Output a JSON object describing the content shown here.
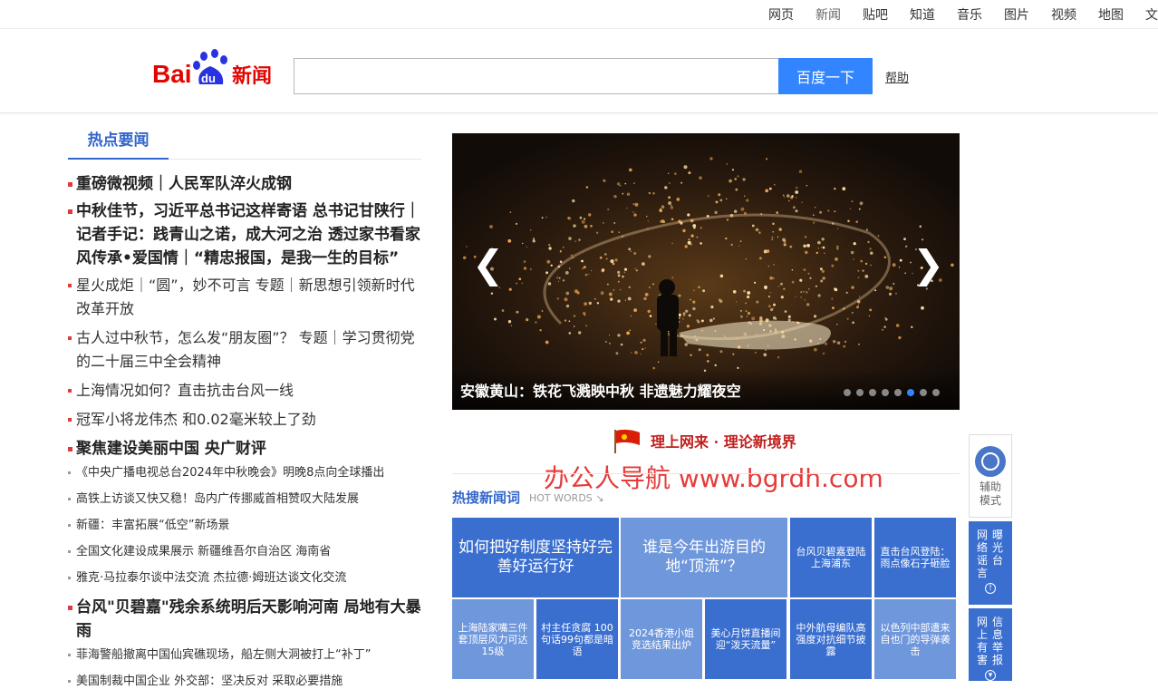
{
  "topnav": {
    "items": [
      "网页",
      "新闻",
      "贴吧",
      "知道",
      "音乐",
      "图片",
      "视频",
      "地图",
      "文库"
    ],
    "active": "新闻"
  },
  "header": {
    "logo_text": "Bai du 新闻",
    "search_value": "",
    "search_button": "百度一下",
    "help": "帮助"
  },
  "hot": {
    "tab_label": "热点要闻",
    "items": [
      {
        "style": "hl",
        "text": "重磅微视频｜人民军队淬火成钢"
      },
      {
        "style": "hl",
        "text": "中秋佳节，习近平总书记这样寄语 总书记甘陕行｜记者手记：践青山之诺，成大河之治 透过家书看家风传承•爱国情｜“精忠报国，是我一生的目标”"
      },
      {
        "style": "md",
        "text": "星火成炬｜“圆”，妙不可言 专题｜新思想引领新时代改革开放"
      },
      {
        "style": "md",
        "text": "古人过中秋节，怎么发“朋友圈”？ 专题｜学习贯彻党的二十届三中全会精神"
      },
      {
        "style": "md",
        "text": "上海情况如何？直击抗击台风一线"
      },
      {
        "style": "md",
        "text": "冠军小将龙伟杰 和0.02毫米较上了劲"
      },
      {
        "style": "hl",
        "text": "聚焦建设美丽中国 央广财评"
      },
      {
        "style": "sm",
        "text": "《中央广播电视总台2024年中秋晚会》明晚8点向全球播出"
      },
      {
        "style": "sm",
        "text": "高铁上访谈又快又稳！岛内广传挪威首相赞叹大陆发展"
      },
      {
        "style": "sm",
        "text": "新疆：丰富拓展“低空”新场景"
      },
      {
        "style": "sm",
        "text": "全国文化建设成果展示 新疆维吾尔自治区 海南省"
      },
      {
        "style": "sm",
        "text": "雅克·马拉泰尔谈中法交流 杰拉德·姆班达谈文化交流"
      },
      {
        "style": "hl",
        "text": "台风\"贝碧嘉\"残余系统明后天影响河南 局地有大暴雨"
      },
      {
        "style": "sm",
        "text": "菲海警船撤离中国仙宾礁现场，船左侧大洞被打上“补丁”"
      },
      {
        "style": "sm",
        "text": "美国制裁中国企业 外交部：坚决反对 采取必要措施"
      }
    ]
  },
  "slider": {
    "caption": "安徽黄山：铁花飞溅映中秋 非遗魅力耀夜空",
    "dot_count": 8,
    "active_dot": 5,
    "prev": "❮",
    "next": "❯"
  },
  "theory": {
    "text": "理上网来 · 理论新境界"
  },
  "watermark": "办公人导航  www.bgrdh.com",
  "hot_words": {
    "title": "热搜新闻词",
    "subtitle": "HOT WORDS ↘",
    "tiles": [
      "如何把好制度坚持好完善好运行好",
      "谁是今年出游目的地“顶流”？",
      "台风贝碧嘉登陆上海浦东",
      "直击台风登陆：雨点像石子砸脸",
      "上海陆家嘴三件套顶层风力可达15级",
      "村主任贪腐 100句话99句都是暗语",
      "2024香港小姐竞选结果出炉",
      "美心月饼直播间迎“泼天流量”",
      "中外航母编队高强度对抗细节披露",
      "以色列中部遭来自也门的导弹袭击"
    ]
  },
  "tools": {
    "access": "辅助模式",
    "exposure": [
      "网络谣言",
      "曝光台"
    ],
    "report": [
      "网上有害",
      "信息举报"
    ]
  }
}
